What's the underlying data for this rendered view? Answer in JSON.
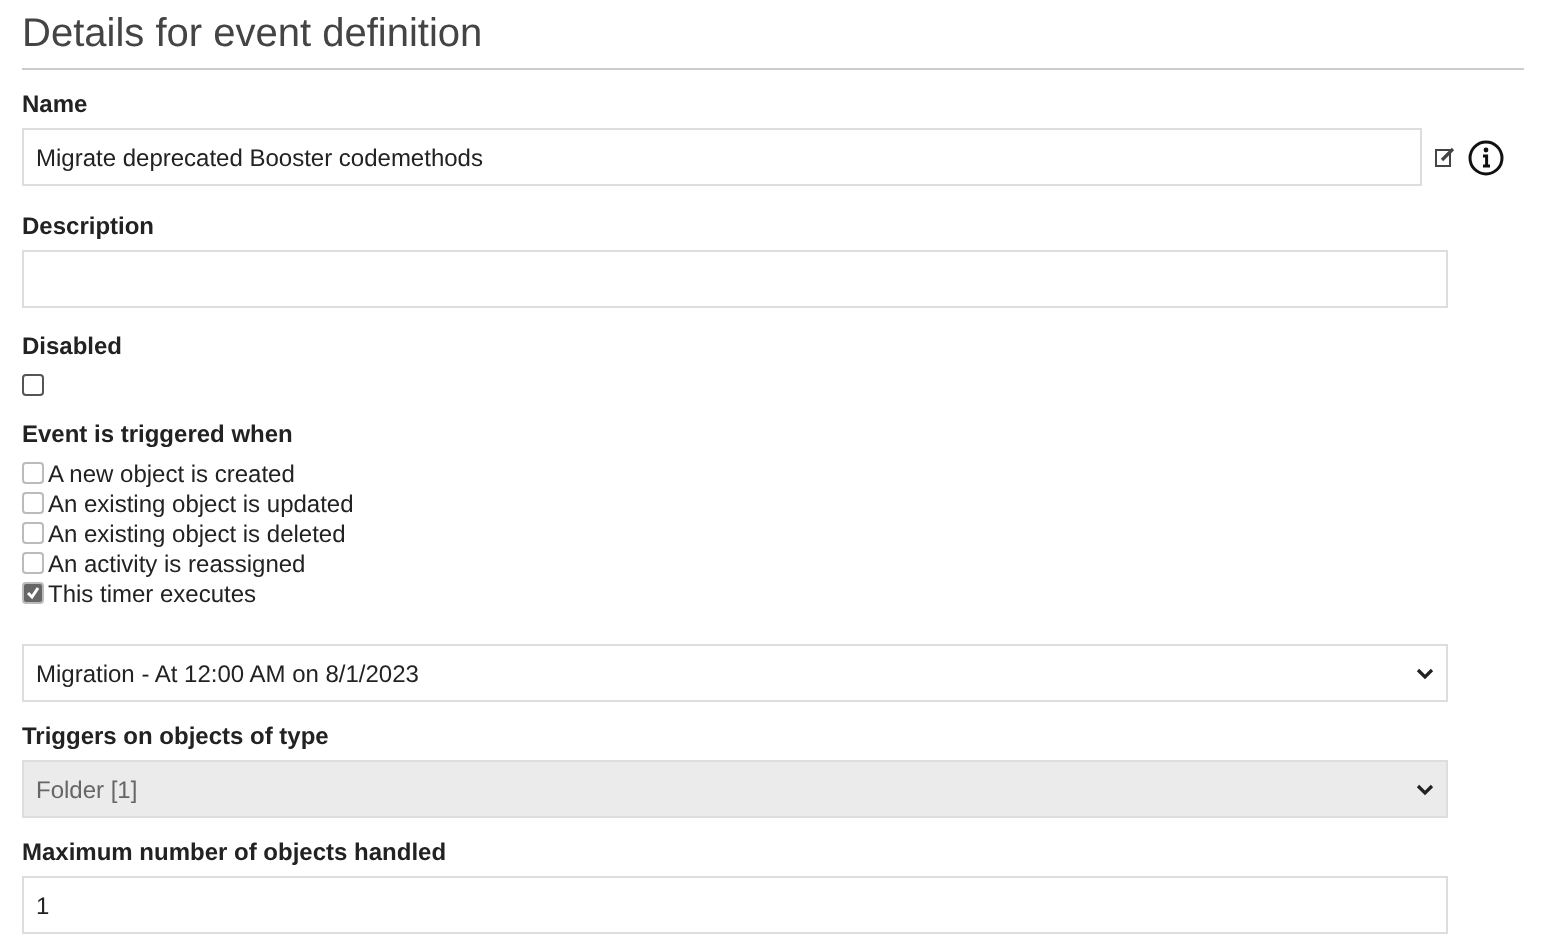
{
  "title": "Details for event definition",
  "name": {
    "label": "Name",
    "value": "Migrate deprecated Booster codemethods"
  },
  "description": {
    "label": "Description"
  },
  "disabled": {
    "label": "Disabled",
    "checked": false
  },
  "triggers": {
    "label": "Event is triggered when",
    "options": [
      {
        "label": "A new object is created",
        "checked": false
      },
      {
        "label": "An existing object is updated",
        "checked": false
      },
      {
        "label": "An existing object is deleted",
        "checked": false
      },
      {
        "label": "An activity is reassigned",
        "checked": false
      },
      {
        "label": "This timer executes",
        "checked": true
      }
    ]
  },
  "timer": {
    "value": "Migration - At 12:00 AM on 8/1/2023",
    "disabled": false
  },
  "object_type": {
    "label": "Triggers on objects of type",
    "value": "Folder [1]",
    "disabled": true
  },
  "max_objects": {
    "label": "Maximum number of objects handled",
    "value": "1"
  }
}
